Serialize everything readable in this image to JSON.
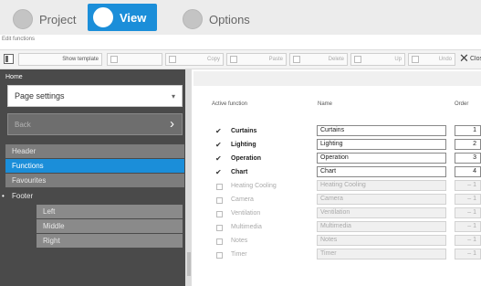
{
  "tabs": [
    {
      "label": "Project",
      "active": false
    },
    {
      "label": "View",
      "active": true
    },
    {
      "label": "Options",
      "active": false
    }
  ],
  "subtitle": "Edit functions",
  "toolbar": {
    "show_template": "Show template",
    "b2": "",
    "copy": "Copy",
    "paste": "Paste",
    "b5": "Delete",
    "b6": "Up",
    "b7": "Undo",
    "b8": "Redo",
    "close": "Close"
  },
  "sidebar": {
    "home": "Home",
    "page_select": "Page settings",
    "back": "Back",
    "items": [
      {
        "label": "Header",
        "selected": false
      },
      {
        "label": "Functions",
        "selected": true
      },
      {
        "label": "Favourites",
        "selected": false
      },
      {
        "label": "Footer",
        "selected": false
      },
      {
        "label": "Left",
        "selected": false
      },
      {
        "label": "Middle",
        "selected": false
      },
      {
        "label": "Right",
        "selected": false
      }
    ]
  },
  "table": {
    "headers": {
      "active": "Active function",
      "name": "Name",
      "order": "Order"
    },
    "rows": [
      {
        "function": "Curtains",
        "name": "Curtains",
        "order": "1",
        "active": true
      },
      {
        "function": "Lighting",
        "name": "Lighting",
        "order": "2",
        "active": true
      },
      {
        "function": "Operation",
        "name": "Operation",
        "order": "3",
        "active": true
      },
      {
        "function": "Chart",
        "name": "Chart",
        "order": "4",
        "active": true
      },
      {
        "function": "Heating Cooling",
        "name": "Heating Cooling",
        "order": "– 1",
        "active": false
      },
      {
        "function": "Camera",
        "name": "Camera",
        "order": "– 1",
        "active": false
      },
      {
        "function": "Ventilation",
        "name": "Ventilation",
        "order": "– 1",
        "active": false
      },
      {
        "function": "Multimedia",
        "name": "Multimedia",
        "order": "– 1",
        "active": false
      },
      {
        "function": "Notes",
        "name": "Notes",
        "order": "– 1",
        "active": false
      },
      {
        "function": "Timer",
        "name": "Timer",
        "order": "– 1",
        "active": false
      }
    ]
  },
  "colors": {
    "accent": "#1b8ed9",
    "sidebar": "#4a4a4a"
  }
}
